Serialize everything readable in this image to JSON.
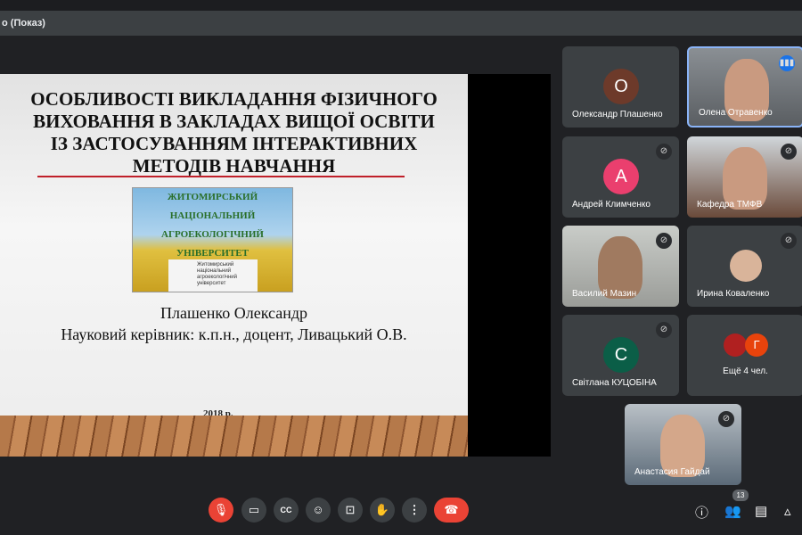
{
  "presentation_bar": {
    "title": "о (Показ)"
  },
  "slide": {
    "title_lines": [
      "ОСОБЛИВОСТІ ВИКЛАДАННЯ ФІЗИЧНОГО",
      "ВИХОВАННЯ  В ЗАКЛАДАХ ВИЩОЇ ОСВІТИ",
      "ІЗ ЗАСТОСУВАННЯМ ІНТЕРАКТИВНИХ",
      "МЕТОДІВ НАВЧАННЯ"
    ],
    "logo_lines": [
      "ЖИТОМИРСЬКИЙ",
      "НАЦІОНАЛЬНИЙ",
      "АГРОЕКОЛОГІЧНИЙ",
      "УНІВЕРСИТЕТ"
    ],
    "logo_card": "Житомирський національний агроекологічний університет",
    "author": "Плашенко Олександр",
    "supervisor": "Науковий керівник: к.п.н., доцент, Ливацький О.В.",
    "year": "2018 р."
  },
  "participants": [
    {
      "name": "Олександр Плашенко",
      "initial": "О",
      "color": "#6d3a2a"
    },
    {
      "name": "Олена Отравенко"
    },
    {
      "name": "Андрей Климченко",
      "initial": "А",
      "color": "#ea3f6e"
    },
    {
      "name": "Кафедра ТМФВ"
    },
    {
      "name": "Василий Мазин"
    },
    {
      "name": "Ирина Коваленко"
    },
    {
      "name": "Світлана КУЦОБІНА",
      "initial": "С",
      "color": "#0b5e47"
    },
    {
      "name": "Ещё 4 чел.",
      "initial": "Г",
      "color": "#e8430c"
    },
    {
      "name": "Анастасия Гайдай"
    }
  ],
  "controls": {
    "participants_count": "13"
  }
}
